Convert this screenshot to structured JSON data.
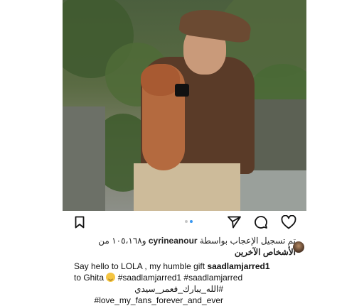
{
  "post": {
    "carousel": {
      "total": 2,
      "active_index": 1
    },
    "likes": {
      "prefix": "تم تسجيل الإعجاب بواسطة",
      "user": "cyrineanour",
      "suffix": "و١٠٥،١٦٨ من",
      "line2": "الأشخاص الآخرين"
    },
    "caption": {
      "line1_text": "Say hello to LOLA , my humble gift ",
      "line1_user": "saadlamjarred1",
      "line2_prefix": "to Ghita ",
      "line2_tags": "#saadlamjarred1 #saadlamjarred",
      "line3": "#الله_يبارك_فعمر_سيدي",
      "line4": "love_my_fans_forever_and_ever#"
    }
  },
  "icons": {
    "save": "bookmark-icon",
    "share": "send-icon",
    "comment": "comment-icon",
    "like": "heart-icon"
  }
}
